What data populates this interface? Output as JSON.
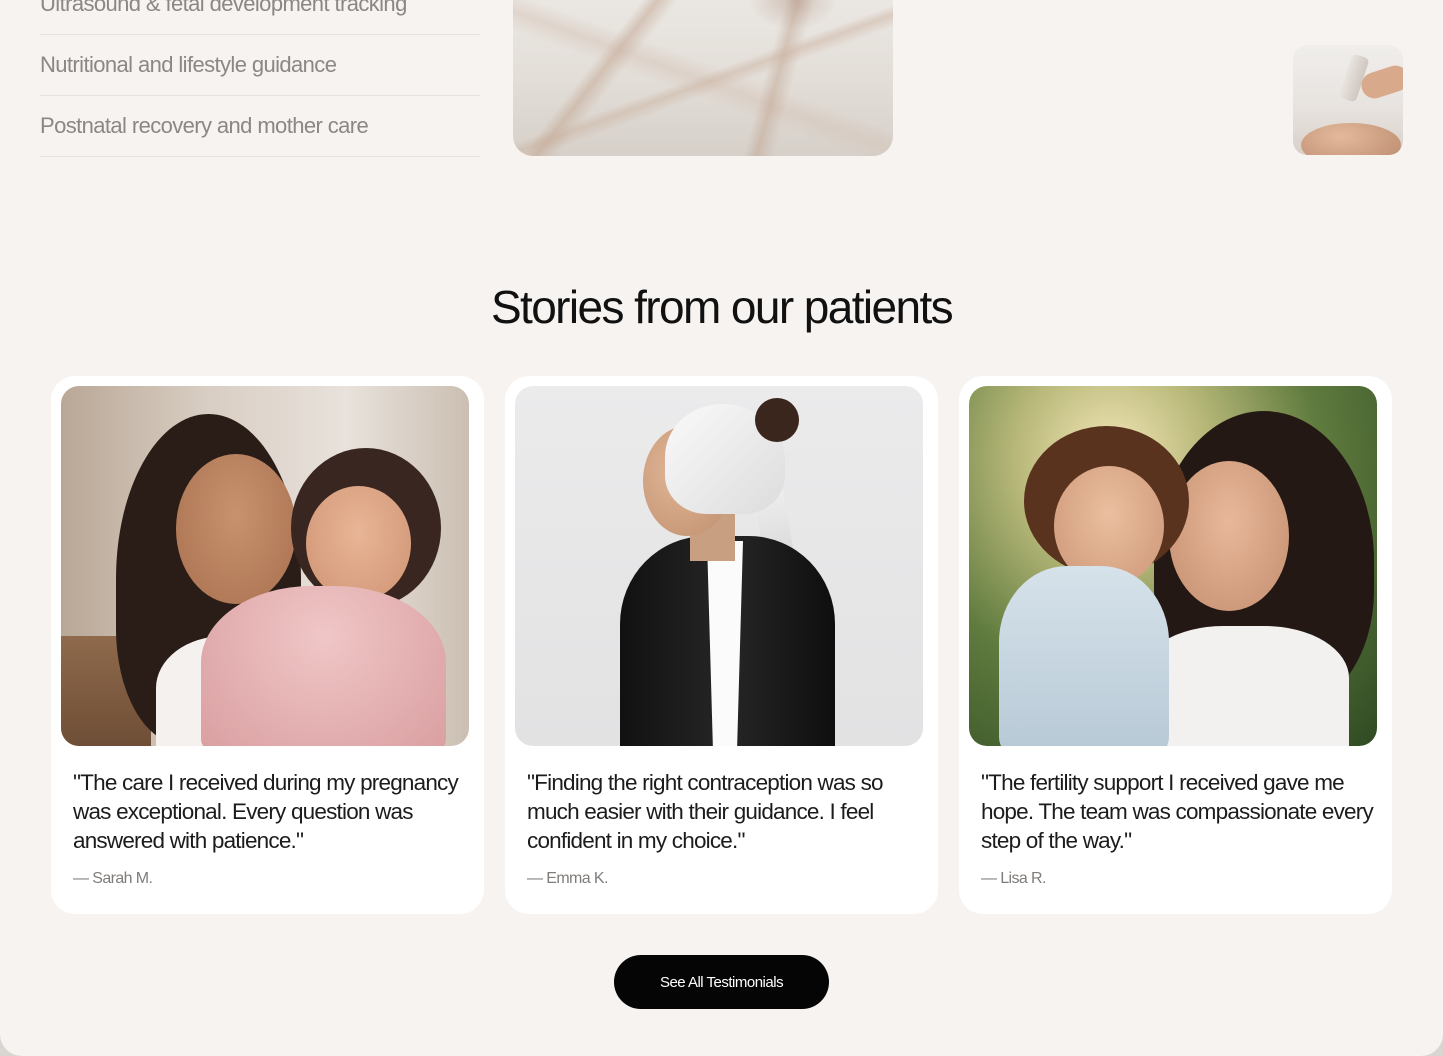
{
  "services": {
    "items": [
      "Ultrasound & fetal development tracking",
      "Nutritional and lifestyle guidance",
      "Postnatal recovery and mother care"
    ]
  },
  "stories": {
    "title": "Stories from our patients",
    "testimonials": [
      {
        "quote": "\"The care I received during my pregnancy was exceptional. Every question was answered with patience.\"",
        "author": "— Sarah M."
      },
      {
        "quote": "\"Finding the right contraception was so much easier with their guidance. I feel confident in my choice.\"",
        "author": "— Emma K."
      },
      {
        "quote": "\"The fertility support I received gave me hope. The team was compassionate every step of the way.\"",
        "author": "— Lisa R."
      }
    ],
    "cta_label": "See All Testimonials"
  },
  "colors": {
    "page_background": "#f7f3f0",
    "card_background": "#ffffff",
    "button_background": "#050505",
    "muted_text": "#8a8784"
  }
}
